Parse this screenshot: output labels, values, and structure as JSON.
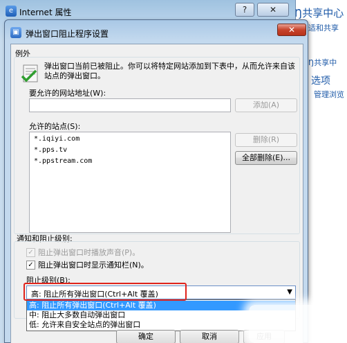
{
  "background": {
    "title": "Ŋ共享中心",
    "links": [
      "适和共享",
      "Ŋ共享中",
      "管理浏览"
    ],
    "section": "选项"
  },
  "props_window": {
    "title": "Internet 属性",
    "help_button": "?",
    "close_button": "✕"
  },
  "dialog": {
    "title": "弹出窗口阻止程序设置",
    "close_button": "✕",
    "exceptions": {
      "group_label": "例外",
      "description": "弹出窗口当前已被阻止。你可以将特定网站添加到下表中，从而允许来自该站点的弹出窗口。",
      "address_label": "要允许的网站地址(W):",
      "address_value": "",
      "add_button": "添加(A)",
      "allowed_label": "允许的站点(S):",
      "allowed_sites": [
        "*.iqiyi.com",
        "*.pps.tv",
        "*.ppstream.com"
      ],
      "remove_button": "删除(R)",
      "remove_all_button": "全部删除(E)..."
    },
    "notification": {
      "group_label": "通知和阻止级别:",
      "play_sound": {
        "label": "阻止弹出窗口时播放声音(P)。",
        "checked": true,
        "disabled": true
      },
      "show_bar": {
        "label": "阻止弹出窗口时显示通知栏(N)。",
        "checked": true,
        "disabled": false
      },
      "level_label": "阻止级别(B):",
      "level_value": "高: 阻止所有弹出窗口(Ctrl+Alt 覆盖)",
      "level_options": [
        "高: 阻止所有弹出窗口(Ctrl+Alt 覆盖)",
        "中: 阻止大多数自动弹出窗口",
        "低: 允许来自安全站点的弹出窗口"
      ]
    },
    "footer": {
      "ok_button": "确定",
      "cancel_button": "取消",
      "apply_button": "应用"
    }
  }
}
